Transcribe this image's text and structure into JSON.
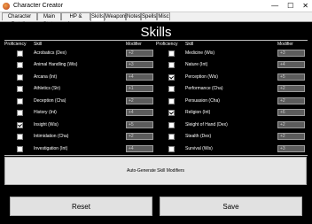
{
  "window": {
    "title": "Character Creator",
    "minimize": "—",
    "maximize": "☐",
    "close": "✕"
  },
  "tabs": [
    {
      "label": "Character Details"
    },
    {
      "label": "Main Stats"
    },
    {
      "label": "HP & Armour"
    },
    {
      "label": "Skills"
    },
    {
      "label": "Weapons"
    },
    {
      "label": "Notes"
    },
    {
      "label": "Spells"
    },
    {
      "label": "Misc"
    }
  ],
  "active_tab": "Skills",
  "heading": "Skills",
  "columns": {
    "proficiency": "Proficiency",
    "skill": "Skill",
    "modifier": "Modifier"
  },
  "skills_left": [
    {
      "name": "Acrobatics (Dex)",
      "proficient": false,
      "modifier": "+2"
    },
    {
      "name": "Animal Handling (Wis)",
      "proficient": false,
      "modifier": "+3"
    },
    {
      "name": "Arcana (Int)",
      "proficient": false,
      "modifier": "+4"
    },
    {
      "name": "Athletics (Str)",
      "proficient": false,
      "modifier": "+1"
    },
    {
      "name": "Deception (Cha)",
      "proficient": false,
      "modifier": "+2"
    },
    {
      "name": "History (Int)",
      "proficient": false,
      "modifier": "+4"
    },
    {
      "name": "Insight (Wis)",
      "proficient": true,
      "modifier": "+5"
    },
    {
      "name": "Intimidation (Cha)",
      "proficient": false,
      "modifier": "+2"
    },
    {
      "name": "Investigation (Int)",
      "proficient": false,
      "modifier": "+4"
    }
  ],
  "skills_right": [
    {
      "name": "Medicine (Wis)",
      "proficient": false,
      "modifier": "+3"
    },
    {
      "name": "Nature (Int)",
      "proficient": false,
      "modifier": "+4"
    },
    {
      "name": "Perception (Wis)",
      "proficient": true,
      "modifier": "+5"
    },
    {
      "name": "Performance (Cha)",
      "proficient": false,
      "modifier": "+2"
    },
    {
      "name": "Persuasion (Cha)",
      "proficient": false,
      "modifier": "+2"
    },
    {
      "name": "Religion (Int)",
      "proficient": true,
      "modifier": "+6"
    },
    {
      "name": "Sleight of Hand (Dex)",
      "proficient": false,
      "modifier": "+2"
    },
    {
      "name": "Stealth (Dex)",
      "proficient": false,
      "modifier": "+2"
    },
    {
      "name": "Survival (Wis)",
      "proficient": false,
      "modifier": "+3"
    }
  ],
  "buttons": {
    "autogen": "Auto-Generate Skill Modifiers",
    "reset": "Reset",
    "save": "Save"
  }
}
